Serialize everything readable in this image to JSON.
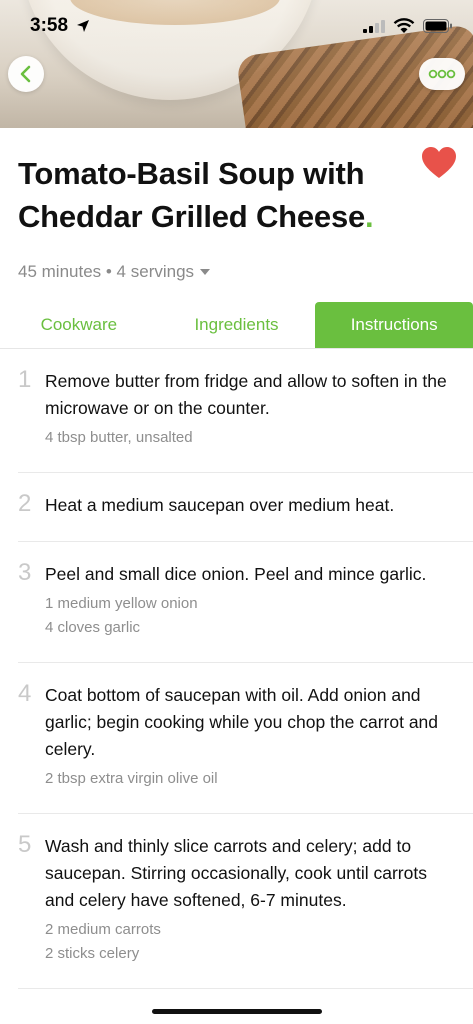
{
  "status_bar": {
    "time": "3:58"
  },
  "recipe": {
    "title": "Tomato-Basil Soup with Cheddar Grilled Cheese",
    "title_dot": ".",
    "meta": "45 minutes • 4 servings"
  },
  "tabs": [
    {
      "label": "Cookware"
    },
    {
      "label": "Ingredients"
    },
    {
      "label": "Instructions"
    }
  ],
  "steps": [
    {
      "number": "1",
      "text": "Remove butter from fridge and allow to soften in the microwave or on the counter.",
      "ingredients": [
        "4 tbsp butter, unsalted"
      ]
    },
    {
      "number": "2",
      "text": "Heat a medium saucepan over medium heat.",
      "ingredients": []
    },
    {
      "number": "3",
      "text": "Peel and small dice onion. Peel and mince garlic.",
      "ingredients": [
        "1 medium yellow onion",
        "4 cloves garlic"
      ]
    },
    {
      "number": "4",
      "text": "Coat bottom of saucepan with oil. Add onion and garlic; begin cooking while you chop the carrot and celery.",
      "ingredients": [
        "2 tbsp extra virgin olive oil"
      ]
    },
    {
      "number": "5",
      "text": "Wash and thinly slice carrots and celery; add to saucepan. Stirring occasionally, cook until carrots and celery have softened, 6-7 minutes.",
      "ingredients": [
        "2 medium carrots",
        "2 sticks celery"
      ]
    }
  ],
  "colors": {
    "accent": "#6abf3f",
    "heart": "#e8524a"
  },
  "icons": [
    "location-arrow-icon",
    "signal-icon",
    "wifi-icon",
    "battery-icon",
    "back-chevron-icon",
    "more-dots-icon",
    "heart-icon",
    "caret-down-icon"
  ]
}
